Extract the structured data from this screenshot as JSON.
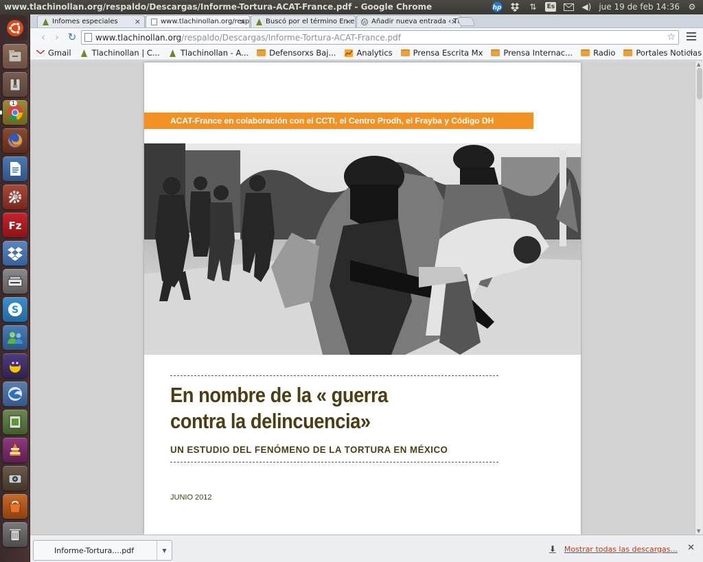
{
  "system": {
    "window_title": "www.tlachinollan.org/respaldo/Descargas/Informe-Tortura-ACAT-France.pdf - Google Chrome",
    "keyboard_layout": "Es",
    "clock": "jue 19 de feb 14:36"
  },
  "launcher": {
    "chrome_badge": "1",
    "items": [
      "ubuntu-dash",
      "files",
      "archive",
      "chrome",
      "firefox",
      "writer",
      "settings",
      "filezilla",
      "dropbox",
      "scanner",
      "skype",
      "empathy",
      "pidgin",
      "thunderbird",
      "sushi",
      "vlc",
      "camera",
      "ubuntu-one",
      "software-center",
      "trash"
    ]
  },
  "tabs": [
    {
      "label": "Infomes especiales",
      "icon": "tlachinollan-icon"
    },
    {
      "label": "www.tlachinollan.org/respaldo",
      "icon": "page-icon"
    },
    {
      "label": "Buscó por el término En el",
      "icon": "tlachinollan-icon"
    },
    {
      "label": "Añadir nueva entrada ‹ Tlac",
      "icon": "wordpress-icon"
    }
  ],
  "omnibox": {
    "host": "www.tlachinollan.org",
    "path": "/respaldo/Descargas/Informe-Tortura-ACAT-France.pdf"
  },
  "bookmarks": [
    {
      "label": "Gmail",
      "icon": "gmail-icon"
    },
    {
      "label": "Tlachinollan | C...",
      "icon": "tlachinollan-icon"
    },
    {
      "label": "Tlachinollan - A...",
      "icon": "tlachinollan-icon"
    },
    {
      "label": "Defensorxs Baj...",
      "icon": "folder-icon"
    },
    {
      "label": "Analytics",
      "icon": "analytics-icon"
    },
    {
      "label": "Prensa Escrita Mx",
      "icon": "folder-icon"
    },
    {
      "label": "Prensa Internac...",
      "icon": "folder-icon"
    },
    {
      "label": "Radio",
      "icon": "folder-icon"
    },
    {
      "label": "Portales Noticias",
      "icon": "folder-icon"
    }
  ],
  "document": {
    "banner": "ACAT-France en colaboración con el CCTI, el Centro Prodh, el Frayba y Código DH",
    "title_line1": "En nombre de la « guerra",
    "title_line2": "contra la delincuencia»",
    "subtitle": "UN ESTUDIO DEL FENÓMENO DE LA TORTURA EN MÉXICO",
    "date": "JUNIO 2012"
  },
  "downloads": {
    "file": "Informe-Tortura....pdf",
    "show_all": "Mostrar todas las descargas..."
  },
  "colors": {
    "accent_orange": "#f39224",
    "title_brown": "#4d3d12",
    "link_red": "#c03b0f"
  }
}
